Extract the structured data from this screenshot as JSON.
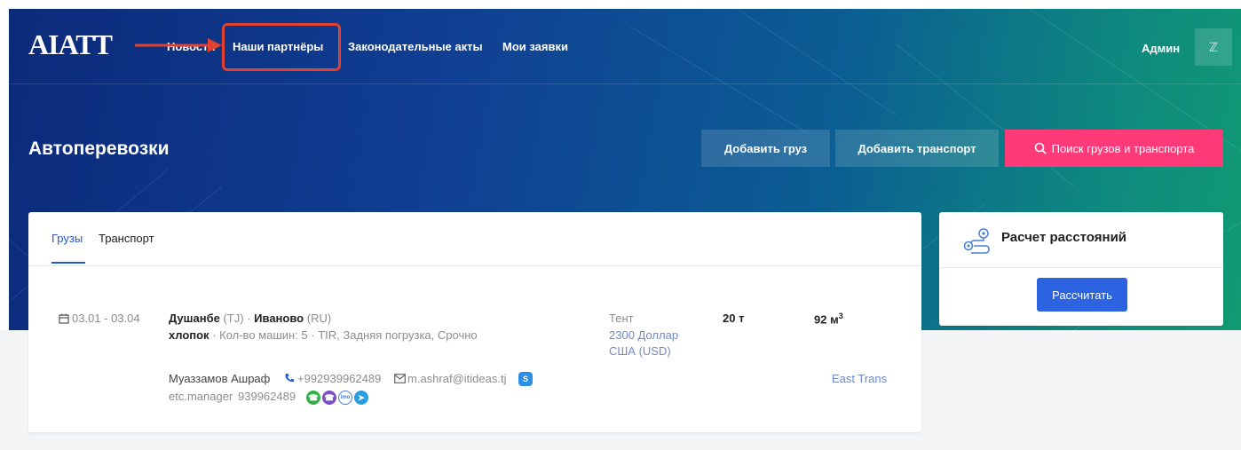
{
  "header": {
    "logo": "AIATT",
    "nav": [
      "Новости",
      "Наши партнёры",
      "Законодательные акты",
      "Мои заявки"
    ],
    "user_name": "Админ",
    "user_icon": "user-icon"
  },
  "page": {
    "title": "Автоперевозки",
    "buttons": {
      "add_cargo": "Добавить груз",
      "add_transport": "Добавить транспорт",
      "search": "Поиск грузов и транспорта"
    }
  },
  "listing": {
    "tabs": [
      "Грузы",
      "Транспорт"
    ],
    "active_tab": "Грузы",
    "item": {
      "dates": "03.01 - 03.04",
      "from_city": "Душанбе",
      "from_country": "(TJ)",
      "separator": "·",
      "to_city": "Иваново",
      "to_country": "(RU)",
      "cargo": "хлопок",
      "details": "· Кол-во машин: 5 · TIR, Задняя погрузка, Срочно",
      "body_type": "Тент",
      "price_line1": "2300 Доллар",
      "price_line2": "США (USD)",
      "weight": "20 т",
      "volume": "92 м",
      "volume_sup": "3",
      "contact_name": "Муаззамов Ашраф",
      "phone": "+992939962489",
      "email": "m.ashraf@itideas.tj",
      "skype": "etc.manager",
      "phone2": "939962489",
      "company": "East Trans"
    }
  },
  "distance_widget": {
    "title": "Расчет расстояний",
    "button": "Рассчитать",
    "icon": "route-icon"
  },
  "colors": {
    "accent_blue": "#2457d6",
    "pink": "#ff3a78",
    "annotation_red": "#e2412f"
  }
}
